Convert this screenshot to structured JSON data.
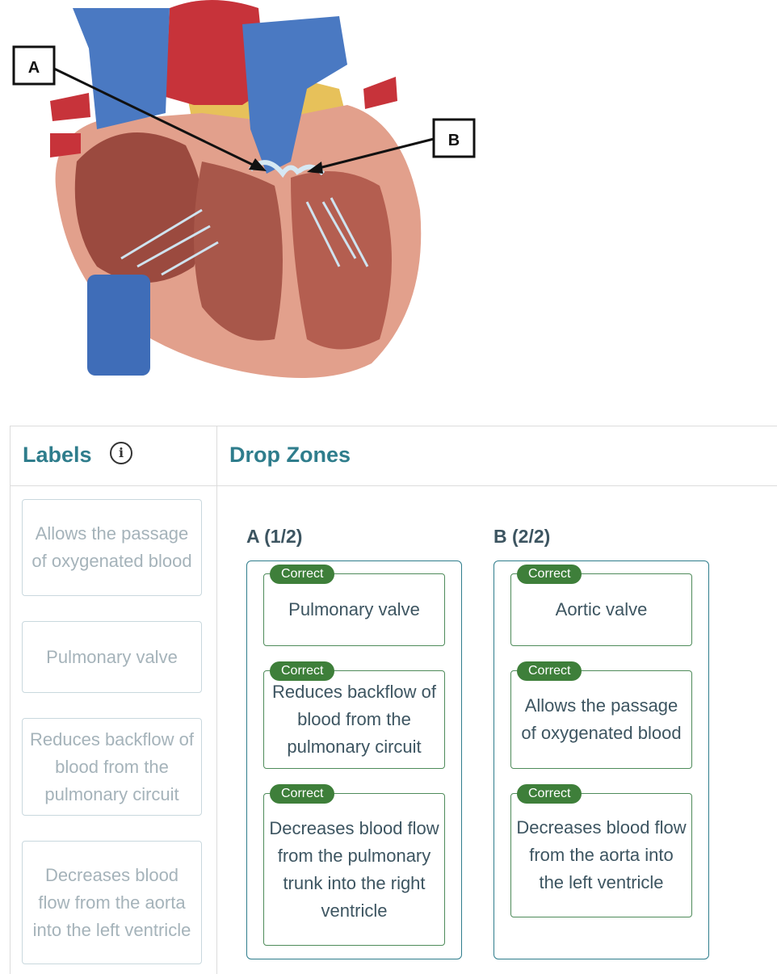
{
  "figure": {
    "callout_a": "A",
    "callout_b": "B"
  },
  "labels_panel": {
    "title": "Labels",
    "info_glyph": "i",
    "items": [
      "Allows the passage of oxygenated blood",
      "Pulmonary valve",
      "Reduces backflow of blood from the pulmonary circuit",
      "Decreases blood flow from the aorta into the left ventricle"
    ]
  },
  "drop_panel": {
    "title": "Drop Zones",
    "zones": [
      {
        "title": "A (1/2)",
        "items": [
          {
            "badge": "Correct",
            "text": "Pulmonary valve"
          },
          {
            "badge": "Correct",
            "text": "Reduces backflow of blood from the pulmonary circuit"
          },
          {
            "badge": "Correct",
            "text": "Decreases blood flow from the pulmonary trunk into the right ventricle"
          }
        ]
      },
      {
        "title": "B (2/2)",
        "items": [
          {
            "badge": "Correct",
            "text": "Aortic valve"
          },
          {
            "badge": "Correct",
            "text": "Allows the passage of oxygenated blood"
          },
          {
            "badge": "Correct",
            "text": "Decreases blood flow from the aorta into the left ventricle"
          }
        ]
      }
    ]
  },
  "colors": {
    "accent": "#2f7d8c",
    "correct_badge": "#3e7f3a",
    "muted_text": "#a5b3ba"
  }
}
